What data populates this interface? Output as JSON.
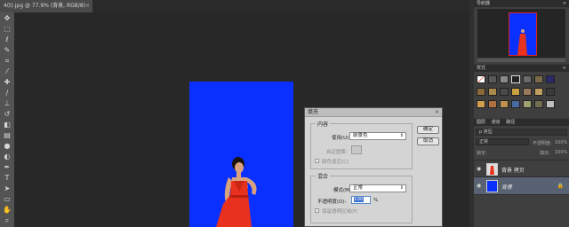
{
  "document_tab": {
    "title": "4(t).jpg @ 77.9% (背景, RGB/8)",
    "close": "×"
  },
  "tools": [
    "move-tool",
    "marquee-tool",
    "lasso-tool",
    "quick-select-tool",
    "crop-tool",
    "eyedropper-tool",
    "healing-tool",
    "brush-tool",
    "stamp-tool",
    "history-brush-tool",
    "eraser-tool",
    "gradient-tool",
    "blur-tool",
    "dodge-tool",
    "pen-tool",
    "type-tool",
    "path-select-tool",
    "shape-tool",
    "hand-tool",
    "zoom-tool"
  ],
  "navigator": {
    "tab": "导航器",
    "menu": "≡"
  },
  "styles": {
    "tab": "样式",
    "menu": "≡"
  },
  "layers": {
    "tabs": [
      "图层",
      "通道",
      "路径"
    ],
    "filter_label": "p 类型",
    "blend_mode": "正常",
    "opacity_label": "不透明度:",
    "opacity_value": "100%",
    "lock_label": "锁定:",
    "fill_label": "填充:",
    "fill_value": "100%",
    "items": [
      {
        "name": "背景 拷贝",
        "visible": true
      },
      {
        "name": "背景",
        "visible": true,
        "locked": true
      }
    ]
  },
  "fill_dialog": {
    "title": "填充",
    "close": "×",
    "content_group": "内容",
    "use_label": "使用(U):",
    "use_value": "前景色",
    "custom_pattern_label": "自定图案:",
    "color_adaptation_label": "颜色适应(C)",
    "blend_group": "混合",
    "mode_label": "模式(M):",
    "mode_value": "正常",
    "opacity_label": "不透明度(O):",
    "opacity_value": "100",
    "opacity_unit": "%",
    "preserve_label": "保留透明区域(P)",
    "ok_button": "确定",
    "cancel_button": "取消"
  },
  "colors": {
    "canvas_blue": "#0a30ff",
    "dress_red": "#e8321e",
    "app_dark": "#282828"
  }
}
